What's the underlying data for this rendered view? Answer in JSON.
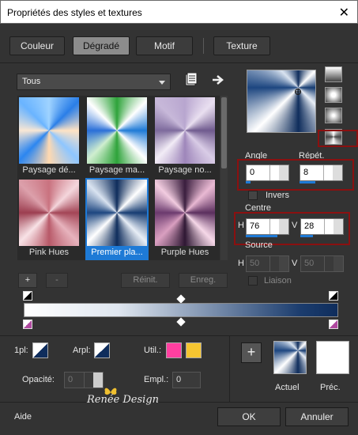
{
  "window": {
    "title": "Propriétés des styles et textures",
    "close_glyph": "✕"
  },
  "tabs": [
    {
      "label": "Couleur",
      "active": false
    },
    {
      "label": "Dégradé",
      "active": true
    },
    {
      "label": "Motif",
      "active": false
    },
    {
      "label": "Texture",
      "active": false
    }
  ],
  "gradient_picker": {
    "category": "Tous",
    "presets": [
      {
        "label": "Paysage dé..."
      },
      {
        "label": "Paysage ma..."
      },
      {
        "label": "Paysage no..."
      },
      {
        "label": "Pink Hues"
      },
      {
        "label": "Premier pla...",
        "selected": true
      },
      {
        "label": "Purple Hues"
      }
    ]
  },
  "preset_buttons": {
    "add": "+",
    "remove": "-",
    "reset": "Réinit.",
    "save": "Enreg."
  },
  "settings": {
    "angle_label": "Angle",
    "angle_value": "0",
    "repeat_label": "Répét.",
    "repeat_value": "8",
    "invert_label": "Invers",
    "center_label": "Centre",
    "center_h_label": "H",
    "center_h_value": "76",
    "center_v_label": "V",
    "center_v_value": "28",
    "source_label": "Source",
    "source_h_label": "H",
    "source_h_value": "50",
    "source_v_label": "V",
    "source_v_value": "50",
    "link_label": "Liaison"
  },
  "gradient_editor": {
    "foreground_label": "1pl:",
    "background_label": "Arpl:",
    "user_label": "Util.:",
    "opacity_label": "Opacité:",
    "opacity_value": "0",
    "location_label": "Empl.:",
    "location_value": "0",
    "user_color_1": "#ff3fa0",
    "user_color_2": "#f5c531"
  },
  "comparison": {
    "current_label": "Actuel",
    "previous_label": "Préc."
  },
  "footer": {
    "help": "Aide",
    "ok": "OK",
    "cancel": "Annuler"
  },
  "watermark": "Renée Design",
  "colors": {
    "accent": "#1e7ad6",
    "highlight_box": "#8b1010"
  }
}
